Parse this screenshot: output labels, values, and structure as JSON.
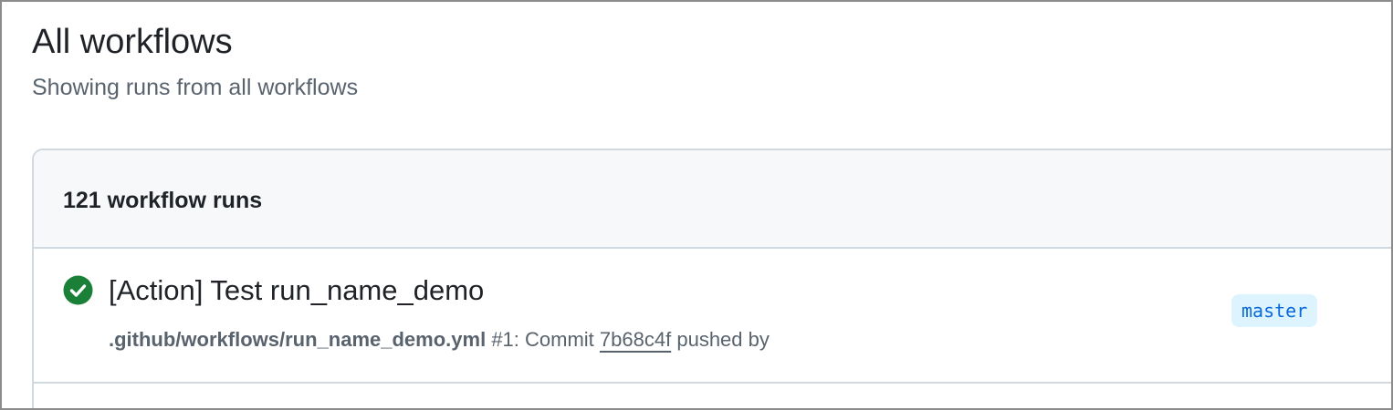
{
  "page": {
    "title": "All workflows",
    "subtitle": "Showing runs from all workflows"
  },
  "runs_header": {
    "count_label": "121 workflow runs"
  },
  "runs": [
    {
      "status": "success",
      "status_icon": "check-circle-fill-icon",
      "status_color": "#1a7f37",
      "title": "[Action] Test run_name_demo",
      "workflow_file": ".github/workflows/run_name_demo.yml",
      "run_number": "#1",
      "event_prefix": ": Commit",
      "commit_sha": "7b68c4f",
      "event_suffix": "pushed by",
      "branch": "master"
    }
  ]
}
